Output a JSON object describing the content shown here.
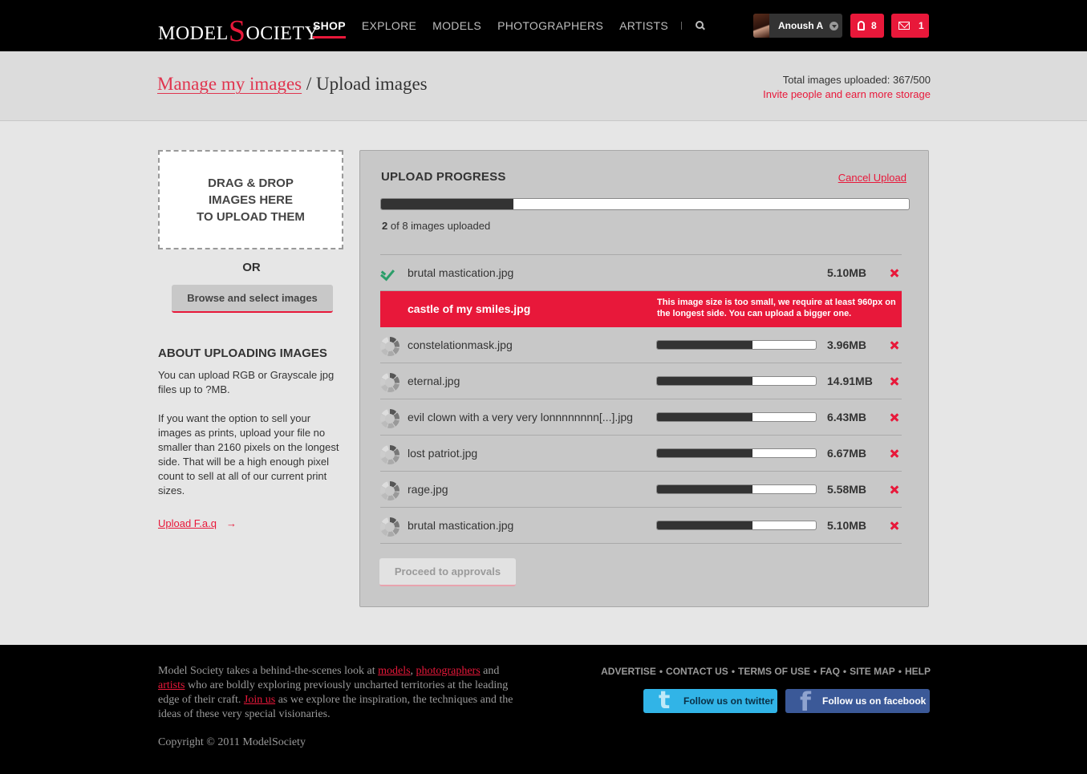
{
  "header": {
    "logo": {
      "prefix": "MODEL",
      "s": "S",
      "suffix": "OCIETY"
    },
    "nav": [
      {
        "label": "SHOP",
        "active": true
      },
      {
        "label": "EXPLORE",
        "active": false
      },
      {
        "label": "MODELS",
        "active": false
      },
      {
        "label": "PHOTOGRAPHERS",
        "active": false
      },
      {
        "label": "ARTISTS",
        "active": false
      }
    ],
    "user": {
      "name": "Anoush A"
    },
    "ideas_count": "8",
    "messages_count": "1"
  },
  "breadcrumb": {
    "link": "Manage my images",
    "separator": "/",
    "current": "Upload images"
  },
  "storage": {
    "total": "Total images uploaded: 367/500",
    "invite": "Invite people and earn more storage"
  },
  "sidebar": {
    "dropzone": "DRAG & DROP\nIMAGES HERE\nTO UPLOAD THEM",
    "or": "OR",
    "browse": "Browse and select images",
    "about_title": "ABOUT UPLOADING IMAGES",
    "about_p1": "You can upload RGB or Grayscale jpg files up to ?MB.",
    "about_p2": "If you want the option to sell your images as prints, upload your file no smaller than 2160 pixels on the longest side. That will be a high enough pixel count to sell at all of our current print sizes.",
    "faq": "Upload F.a.q",
    "faq_arrow": "→"
  },
  "upload": {
    "title": "UPLOAD PROGRESS",
    "cancel": "Cancel Upload",
    "overall_progress": 0.25,
    "count_done": "2",
    "count_text": "of 8 images uploaded",
    "files": [
      {
        "name": "brutal mastication.jpg",
        "status": "done",
        "size": "5.10MB"
      },
      {
        "name": "castle of my smiles.jpg",
        "status": "error",
        "error": "This image size is too small, we require at least 960px on the longest side. You can upload a bigger one."
      },
      {
        "name": "constelationmask.jpg",
        "status": "uploading",
        "progress": 0.6,
        "size": "3.96MB"
      },
      {
        "name": "eternal.jpg",
        "status": "uploading",
        "progress": 0.6,
        "size": "14.91MB"
      },
      {
        "name": "evil clown with a very very lonnnnnnnn[...].jpg",
        "status": "uploading",
        "progress": 0.6,
        "size": "6.43MB"
      },
      {
        "name": "lost patriot.jpg",
        "status": "uploading",
        "progress": 0.6,
        "size": "6.67MB"
      },
      {
        "name": "rage.jpg",
        "status": "uploading",
        "progress": 0.6,
        "size": "5.58MB"
      },
      {
        "name": "brutal mastication.jpg",
        "status": "uploading",
        "progress": 0.6,
        "size": "5.10MB"
      }
    ],
    "proceed": "Proceed to approvals"
  },
  "footer": {
    "about": {
      "t1": "Model Society takes a behind-the-scenes look at",
      "models": "models",
      "comma": ",",
      "photographers": "photographers",
      "and": "and",
      "artists": "artists",
      "t2": "who are boldly exploring previously uncharted territories at the leading edge of their craft.",
      "join": "Join us",
      "t3": "as we explore the inspiration, the techniques and the ideas of these very special visionaries."
    },
    "copyright": "Copyright © 2011 ModelSociety",
    "links": [
      "ADVERTISE",
      "CONTACT US",
      "TERMS OF USE",
      "FAQ",
      "SITE MAP",
      "HELP"
    ],
    "link_separator": "•",
    "twitter": "Follow us on twitter",
    "facebook": "Follow us on facebook"
  },
  "colors": {
    "accent": "#e8183a",
    "check": "#2c9e6a",
    "twitter": "#31b4e7",
    "facebook": "#3b5998"
  }
}
